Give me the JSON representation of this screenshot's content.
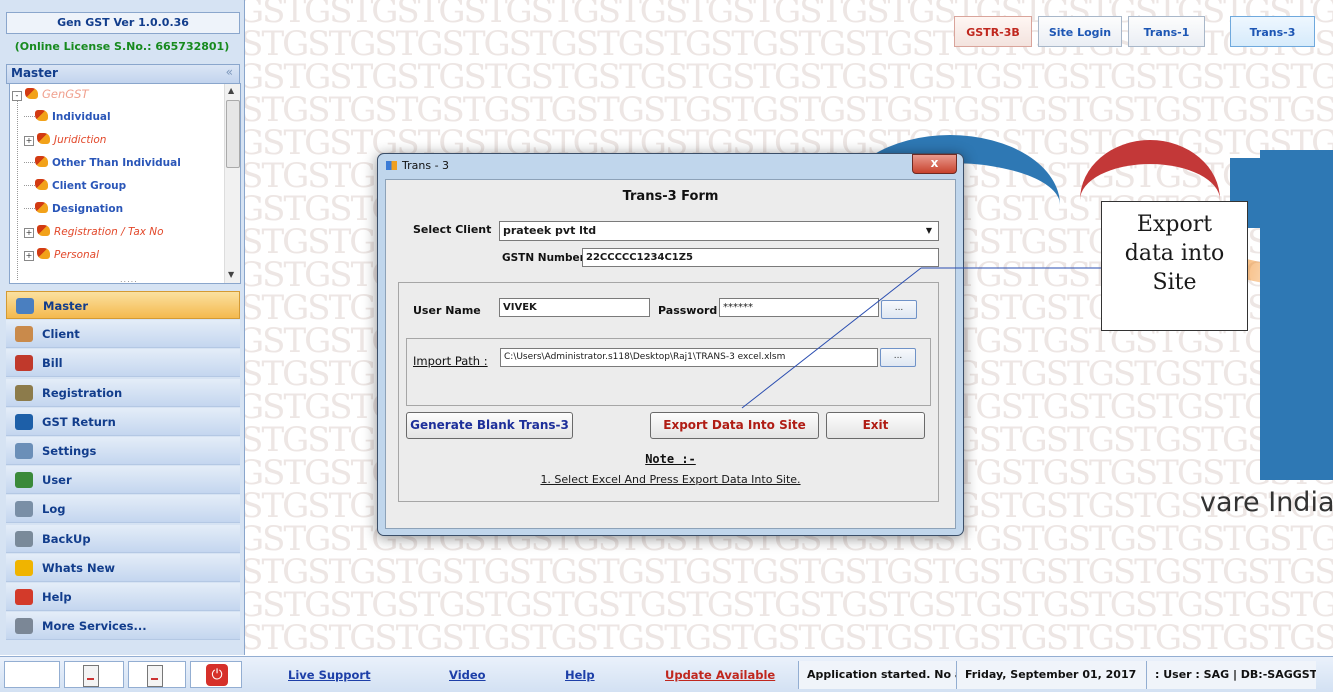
{
  "app": {
    "title": "Gen GST  Ver 1.0.0.36",
    "license": "(Online License S.No.: 665732801)"
  },
  "master_panel": {
    "header": "Master",
    "collapse_glyph": "«",
    "tree": [
      {
        "label": "GenGST",
        "style": "root",
        "expander": "-"
      },
      {
        "label": "Individual",
        "style": "plain",
        "expander": ""
      },
      {
        "label": "Juridiction",
        "style": "ital",
        "expander": "+"
      },
      {
        "label": "Other Than Individual",
        "style": "plain",
        "expander": ""
      },
      {
        "label": "Client Group",
        "style": "plain",
        "expander": ""
      },
      {
        "label": "Designation",
        "style": "plain",
        "expander": ""
      },
      {
        "label": "Registration / Tax No",
        "style": "ital",
        "expander": "+"
      },
      {
        "label": "Personal",
        "style": "ital",
        "expander": "+"
      }
    ]
  },
  "nav": [
    {
      "label": "Master",
      "icon": "master-icon",
      "color": "#4a7fc0"
    },
    {
      "label": "Client",
      "icon": "client-icon",
      "color": "#c98a4b"
    },
    {
      "label": "Bill",
      "icon": "bill-icon",
      "color": "#c0392b"
    },
    {
      "label": "Registration",
      "icon": "registration-icon",
      "color": "#8c7b4b"
    },
    {
      "label": "GST Return",
      "icon": "gst-return-icon",
      "color": "#1d5fa8"
    },
    {
      "label": "Settings",
      "icon": "settings-icon",
      "color": "#6b8fb8"
    },
    {
      "label": "User",
      "icon": "user-icon",
      "color": "#3a8a3a"
    },
    {
      "label": "Log",
      "icon": "log-icon",
      "color": "#7a8fa6"
    },
    {
      "label": "BackUp",
      "icon": "backup-icon",
      "color": "#7a8a9a"
    },
    {
      "label": "Whats New",
      "icon": "whats-new-icon",
      "color": "#f0b400"
    },
    {
      "label": "Help",
      "icon": "help-icon",
      "color": "#d33a2a"
    },
    {
      "label": "More Services...",
      "icon": "more-services-icon",
      "color": "#7b8796"
    }
  ],
  "top_buttons": [
    {
      "label": "GSTR-3B",
      "color": "#c0271e"
    },
    {
      "label": "Site Login",
      "color": "#1d56b4"
    },
    {
      "label": "Trans-1",
      "color": "#1d56b4"
    },
    {
      "label": "Trans-3",
      "color": "#1d56b4"
    }
  ],
  "background": {
    "watermark_text": "GST",
    "brand_text": "vare India"
  },
  "dialog": {
    "window_title": "Trans - 3",
    "close_glyph": "x",
    "form_title": "Trans-3 Form",
    "select_client_label": "Select Client",
    "select_client_value": "prateek pvt ltd",
    "gstn_label": "GSTN Number",
    "gstn_value": "22CCCCC1234C1Z5",
    "user_name_label": "User Name",
    "user_name_value": "VIVEK",
    "password_label": "Password",
    "password_value": "******",
    "browse_label": "...",
    "import_path_label": "Import Path :",
    "import_path_value": "C:\\Users\\Administrator.s118\\Desktop\\Raj1\\TRANS-3 excel.xlsm",
    "generate_button": "Generate Blank Trans-3",
    "export_button": "Export Data Into Site",
    "exit_button": "Exit",
    "note_title": "Note :-",
    "note_text": "1. Select Excel And Press Export Data Into Site."
  },
  "callout": {
    "line1": "Export",
    "line2": "data into",
    "line3": "Site"
  },
  "bottom": {
    "links": [
      {
        "label": "Live Support",
        "color": "#1d3fa8"
      },
      {
        "label": "Video",
        "color": "#1d3fa8"
      },
      {
        "label": "Help",
        "color": "#1d3fa8"
      },
      {
        "label": "Update Available",
        "color": "#c0271e"
      }
    ],
    "status_message": "Application started. No a",
    "date": "Friday, September 01, 2017",
    "user_db": ": User : SAG | DB:-SAGGST"
  }
}
